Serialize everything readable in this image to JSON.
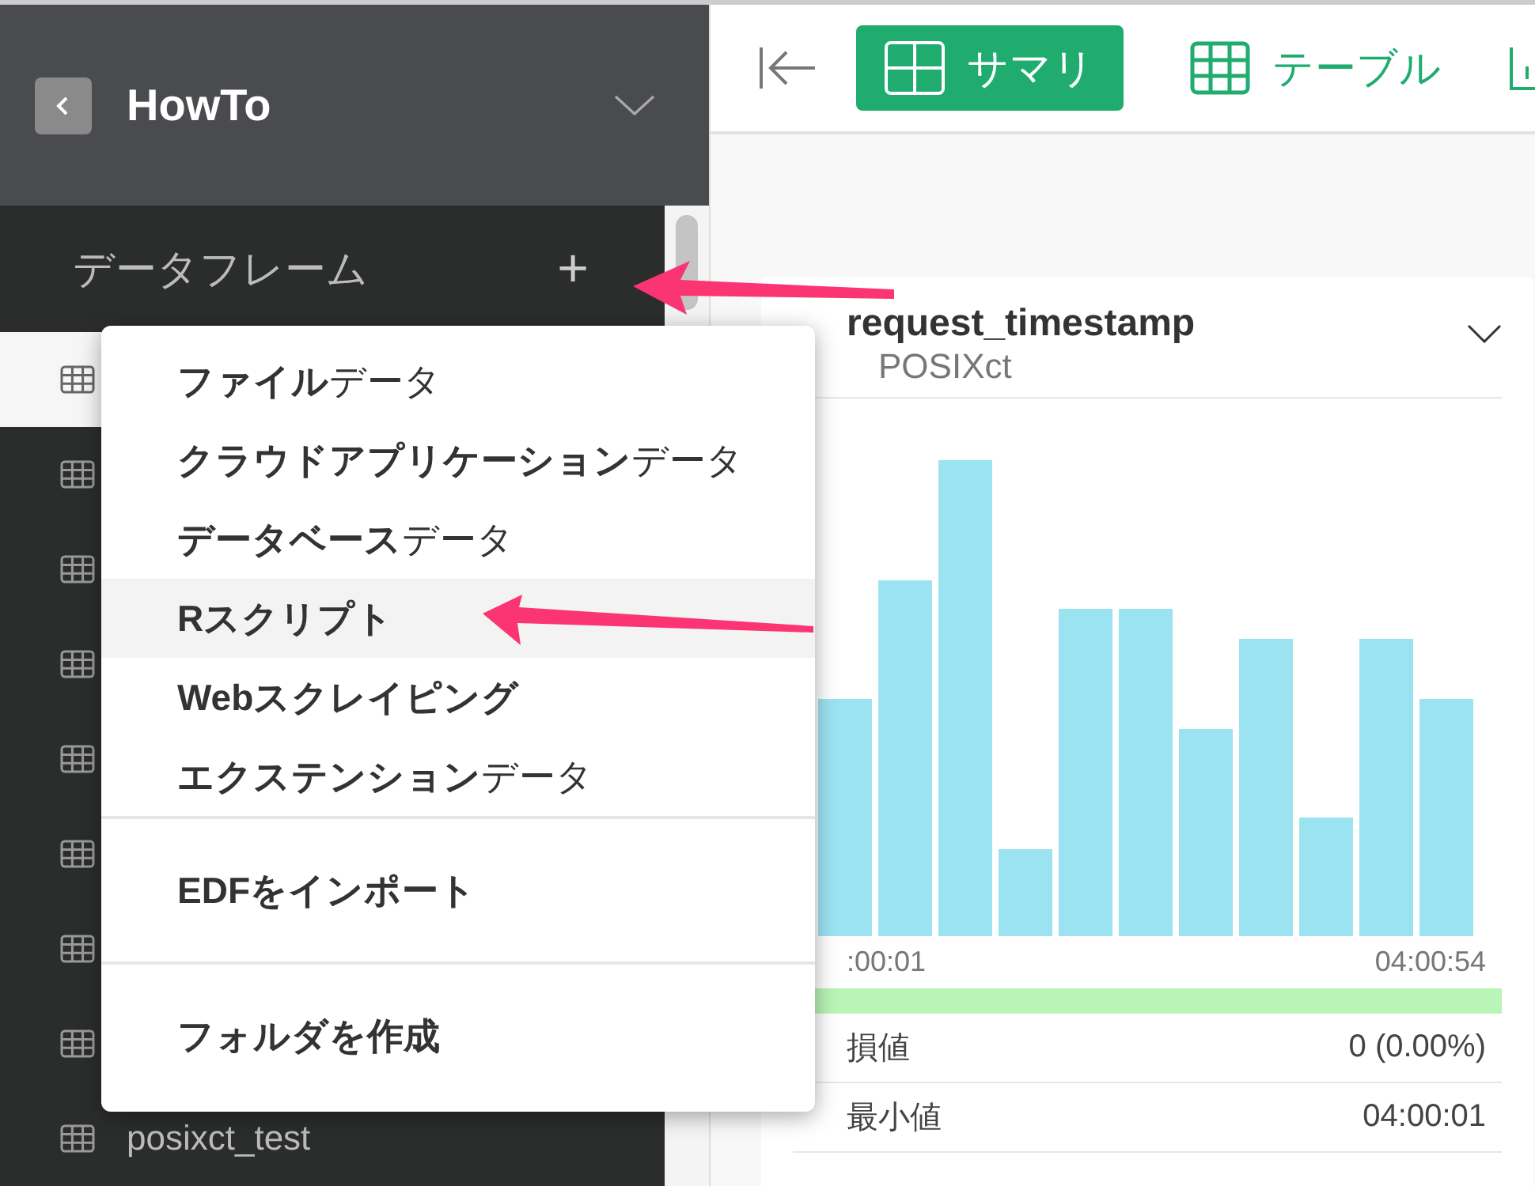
{
  "project": {
    "title": "HowTo"
  },
  "sidebar": {
    "section_title": "データフレーム",
    "add_label": "+",
    "items": [
      {
        "selected": true
      },
      {
        "selected": false
      },
      {
        "selected": false
      },
      {
        "selected": false
      },
      {
        "selected": false
      },
      {
        "selected": false
      },
      {
        "selected": false
      },
      {
        "selected": false
      },
      {
        "label": "posixct_test",
        "selected": false
      }
    ]
  },
  "toolbar": {
    "tabs": [
      {
        "label": "サマリ",
        "kind": "summary",
        "selected": true
      },
      {
        "label": "テーブル",
        "kind": "table",
        "selected": false
      },
      {
        "kind": "chart",
        "selected": false
      }
    ]
  },
  "menu": {
    "groups": [
      [
        {
          "label": "**ファイル**データ",
          "highlighted": false
        },
        {
          "label": "**クラウドアプリケーション**データ",
          "highlighted": false
        },
        {
          "label": "**データベース**データ",
          "highlighted": false
        },
        {
          "label": "**Rスクリプト**",
          "highlighted": true
        },
        {
          "label": "**Webスクレイピング**",
          "highlighted": false
        },
        {
          "label": "**エクステンション**データ",
          "highlighted": false
        }
      ],
      [
        {
          "label": "**EDFをインポート**",
          "highlighted": false
        }
      ],
      [
        {
          "label": "**フォルダを作成**",
          "highlighted": false
        }
      ]
    ]
  },
  "card": {
    "title": "request_timestamp",
    "type": "POSIXct",
    "axis_min": ":00:01",
    "axis_max": "04:00:54",
    "valid": {
      "level": 1.0
    },
    "stats": [
      {
        "label": "損値",
        "value": "0 (0.00%)"
      },
      {
        "label": "最小値",
        "value": "04:00:01"
      }
    ]
  }
}
